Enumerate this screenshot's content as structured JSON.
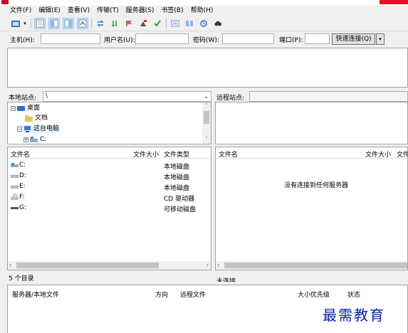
{
  "menu": [
    "文件(F)",
    "编辑(E)",
    "查看(V)",
    "传输(T)",
    "服务器(S)",
    "书签(B)",
    "帮助(H)"
  ],
  "toolbar_icons": [
    "site-manager-icon",
    "dropdown-arrow-icon",
    "toggle-log-icon",
    "toggle-local-tree-icon",
    "toggle-remote-tree-icon",
    "toggle-queue-icon",
    "refresh-icon",
    "process-queue-icon",
    "cancel-icon",
    "disconnect-icon",
    "reconnect-icon",
    "filter-icon",
    "compare-icon",
    "sync-browse-icon",
    "search-icon"
  ],
  "quickconnect": {
    "host_label": "主机(H):",
    "user_label": "用户名(U):",
    "pass_label": "密码(W):",
    "port_label": "端口(P):",
    "connect_button": "快速连接(Q)",
    "dropdown": "▾",
    "host_value": "",
    "user_value": "",
    "pass_value": "",
    "port_value": ""
  },
  "local": {
    "site_label": "本地站点:",
    "path": "\\",
    "tree": [
      {
        "label": "桌面",
        "icon": "desktop-icon"
      },
      {
        "label": "文档",
        "icon": "folder-icon"
      },
      {
        "label": "这台电脑",
        "icon": "computer-icon"
      },
      {
        "label": "C:",
        "icon": "drive-icon"
      }
    ],
    "columns": [
      "文件名",
      "文件大小",
      "文件类型"
    ],
    "files": [
      {
        "name": "C:",
        "type": "本地磁盘",
        "icon": "windows-drive-icon"
      },
      {
        "name": "D:",
        "type": "本地磁盘",
        "icon": "drive-icon"
      },
      {
        "name": "E:",
        "type": "本地磁盘",
        "icon": "drive-icon"
      },
      {
        "name": "F:",
        "type": "CD 驱动器",
        "icon": "cd-drive-icon"
      },
      {
        "name": "G:",
        "type": "可移动磁盘",
        "icon": "removable-drive-icon"
      }
    ],
    "status": "5 个目录"
  },
  "remote": {
    "site_label": "远程站点:",
    "columns": [
      "文件名",
      "文件大小",
      "文件"
    ],
    "empty_message": "没有连接到任何服务器",
    "status": "未连接"
  },
  "queue": {
    "columns": [
      "服务器/本地文件",
      "方向",
      "远程文件",
      "大小",
      "优先级",
      "状态"
    ]
  },
  "watermark": "最需教育",
  "colors": {
    "accent": "#0a1fa8",
    "close": "#e81123",
    "app": "#c8102e"
  }
}
